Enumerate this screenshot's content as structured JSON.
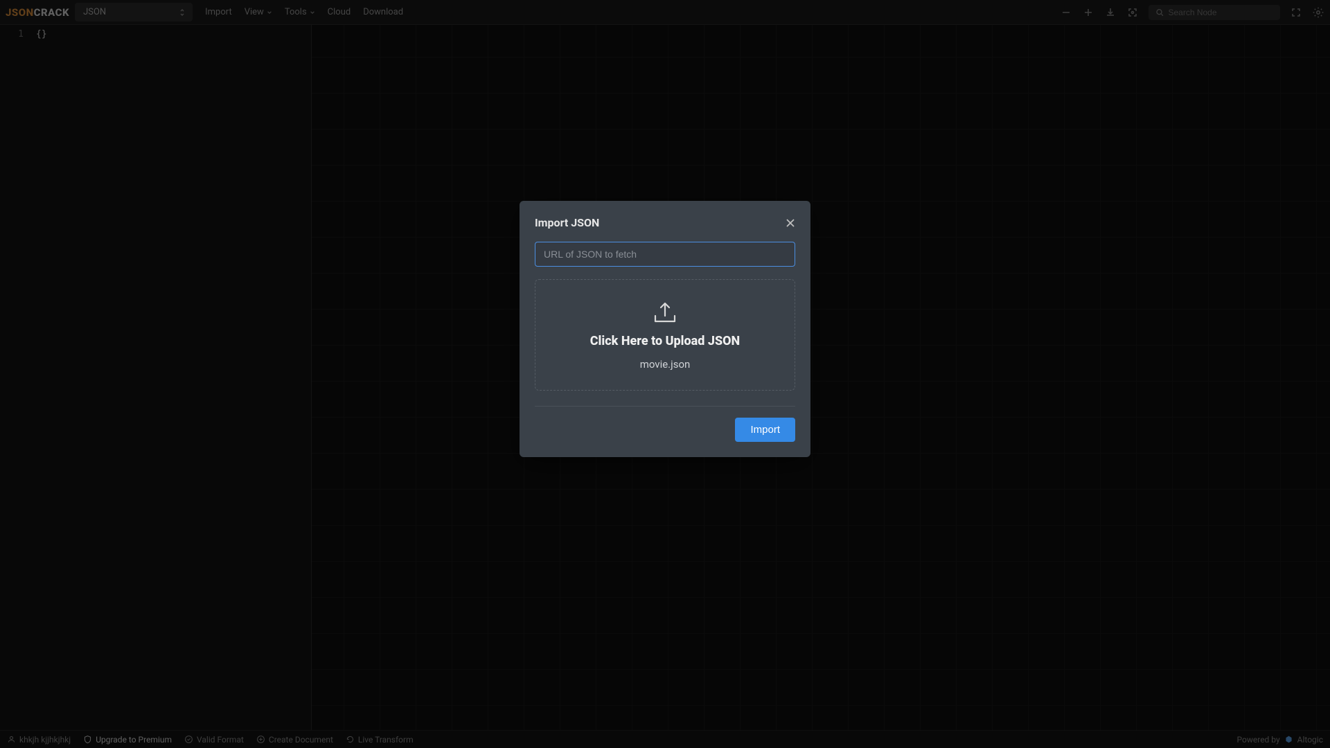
{
  "logo": {
    "part1": "JSON",
    "part2": "CRACK"
  },
  "format_selected": "JSON",
  "menu": {
    "import": "Import",
    "view": "View",
    "tools": "Tools",
    "cloud": "Cloud",
    "download": "Download"
  },
  "search_placeholder": "Search Node",
  "editor": {
    "line_number": "1",
    "content": "{}"
  },
  "status": {
    "user": "khkjh kjjhkjhkj",
    "upgrade": "Upgrade to Premium",
    "valid": "Valid Format",
    "create": "Create Document",
    "live": "Live Transform",
    "powered_by": "Powered by",
    "brand": "Altogic"
  },
  "modal": {
    "title": "Import JSON",
    "url_placeholder": "URL of JSON to fetch",
    "drop_title": "Click Here to Upload JSON",
    "file_name": "movie.json",
    "import_btn": "Import"
  }
}
